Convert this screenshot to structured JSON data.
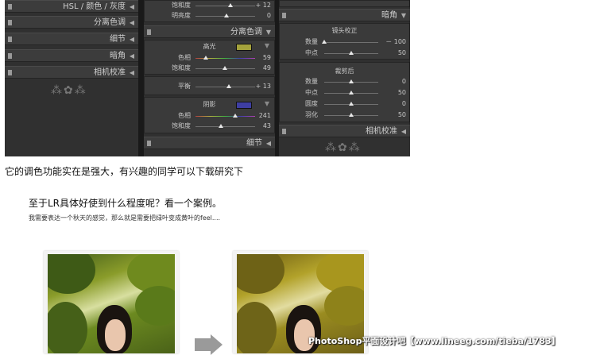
{
  "lr": {
    "left": {
      "hsl_header": "HSL / 颜色 / 灰度",
      "split_toning": "分离色调",
      "detail": "细节",
      "vignette": "暗角",
      "camera_calibration": "相机校准"
    },
    "middle": {
      "top_rows": [
        {
          "label": "饱和度",
          "value": "+ 12"
        },
        {
          "label": "明亮度",
          "value": "0"
        }
      ],
      "section_title": "分离色调",
      "highlights": {
        "title": "高光",
        "rows": [
          {
            "label": "色相",
            "value": "59"
          },
          {
            "label": "饱和度",
            "value": "49"
          }
        ]
      },
      "balance": {
        "label": "平衡",
        "value": "+ 13"
      },
      "shadows": {
        "title": "阴影",
        "rows": [
          {
            "label": "色相",
            "value": "241"
          },
          {
            "label": "饱和度",
            "value": "43"
          }
        ]
      },
      "detail": "细节"
    },
    "right": {
      "vignette": "暗角",
      "lens_correction": {
        "title": "镜头校正",
        "rows": [
          {
            "label": "数量",
            "value": "－ 100"
          },
          {
            "label": "中点",
            "value": "50"
          }
        ]
      },
      "post_crop": {
        "title": "裁剪后",
        "rows": [
          {
            "label": "数量",
            "value": "0"
          },
          {
            "label": "中点",
            "value": "50"
          },
          {
            "label": "圆度",
            "value": "0"
          },
          {
            "label": "羽化",
            "value": "50"
          }
        ]
      },
      "camera_calibration": "相机校准"
    }
  },
  "article": {
    "caption": "它的调色功能实在是强大，有兴趣的同学可以下载研究下",
    "heading": "至于LR具体好使到什么程度呢？看一个案例。",
    "subline": "我需要表达一个秋天的感觉，那么就是需要把绿叶变成黄叶的feel....",
    "watermark": "PhotoShop平面设计吧【www.lineeg.com/tieba/1783】"
  },
  "colors": {
    "highlight_swatch": "#a4a23c",
    "shadow_swatch": "#3e3ea2"
  },
  "slider_levels": {
    "mid_top_0": 0.58,
    "mid_top_1": 0.52,
    "hl_0": 0.17,
    "hl_1": 0.49,
    "bal": 0.56,
    "sh_0": 0.67,
    "sh_1": 0.43,
    "lens_0": 0.0,
    "lens_1": 0.5,
    "crop_0": 0.5,
    "crop_1": 0.5,
    "crop_2": 0.5,
    "crop_3": 0.5
  }
}
